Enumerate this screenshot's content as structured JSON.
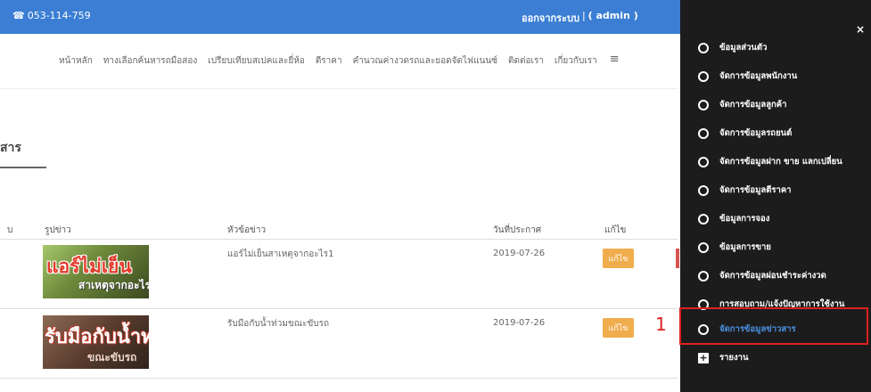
{
  "topbar": {
    "phone": "053-114-759",
    "logout": "ออกจากระบบ",
    "separator": "|",
    "user": "( admin )"
  },
  "nav": {
    "items": [
      "หน้าหลัก",
      "ทางเลือกค้นหารถมือสอง",
      "เปรียบเทียบสเปคและยี่ห้อ",
      "ตีราคา",
      "คำนวณค่างวดรถและยอดจัดไฟแนนซ์",
      "ติดต่อเรา",
      "เกี่ยวกับเรา"
    ],
    "menu_icon": "≡"
  },
  "page": {
    "title": "สาร"
  },
  "table": {
    "headers": {
      "col0": "บ",
      "image": "รูปข่าว",
      "headline": "หัวข้อข่าว",
      "date": "วันที่ประกาศ",
      "edit": "แก้ไข"
    },
    "rows": [
      {
        "thumb_big": "แอร์ไม่เย็น",
        "thumb_small": "สาเหตุจากอะไร",
        "headline": "แอร์ไม่เย็นสาเหตุจากอะไร1",
        "date": "2019-07-26",
        "edit": "แก้ไข"
      },
      {
        "thumb_big": "รับมือกับน้ำท่วม",
        "thumb_small": "ขณะขับรถ",
        "headline": "รับมือกับน้ำท่วมขณะขับรถ",
        "date": "2019-07-26",
        "edit": "แก้ไข"
      }
    ]
  },
  "annotation": "1",
  "panel": {
    "close": "×",
    "items": [
      "ข้อมูลส่วนตัว",
      "จัดการข้อมูลพนักงาน",
      "จัดการข้อมูลลูกค้า",
      "จัดการข้อมูลรถยนต์",
      "จัดการข้อมูลฝาก ขาย แลกเปลี่ยน",
      "จัดการข้อมูลตีราคา",
      "ข้อมูลการจอง",
      "ข้อมูลการขาย",
      "จัดการข้อมูลผ่อนชำระค่างวด",
      "การสอบถาม/แจ้งปัญหาการใช้งาน",
      "จัดการข้อมูลข่าวสาร"
    ],
    "report": "รายงาน",
    "colors": {
      "active": "#4a90e2",
      "highlight": "#e0201f",
      "panel_bg": "#1c1c1c",
      "topbar": "#3b7ed3",
      "edit_button": "#f0ad4e"
    }
  }
}
